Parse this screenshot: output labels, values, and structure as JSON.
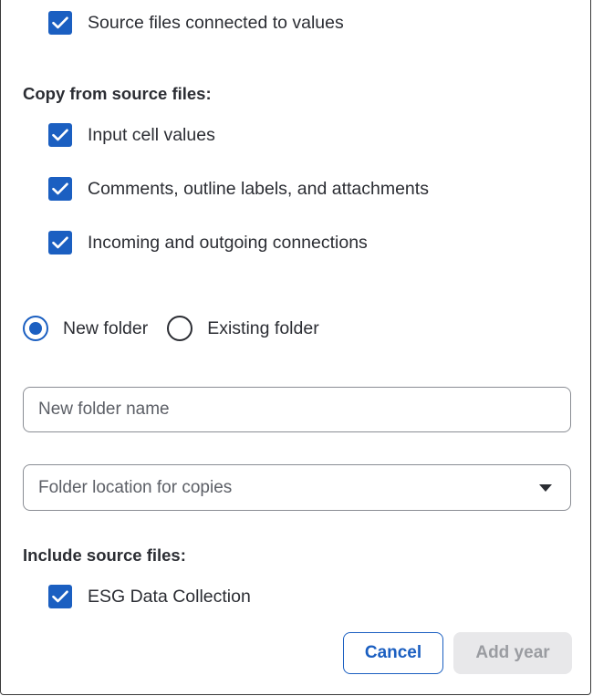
{
  "options": {
    "source_connected": {
      "label": "Source files connected to values",
      "checked": true
    }
  },
  "copy_section": {
    "title": "Copy from source files:",
    "items": [
      {
        "label": "Input cell values",
        "checked": true
      },
      {
        "label": "Comments, outline labels, and attachments",
        "checked": true
      },
      {
        "label": "Incoming and outgoing connections",
        "checked": true
      }
    ]
  },
  "folder_choice": {
    "new_label": "New folder",
    "existing_label": "Existing folder",
    "selected": "new"
  },
  "new_folder_input": {
    "placeholder": "New folder name",
    "value": ""
  },
  "location_select": {
    "placeholder": "Folder location for copies"
  },
  "include_section": {
    "title": "Include source files:",
    "items": [
      {
        "label": "ESG Data Collection",
        "checked": true
      }
    ]
  },
  "actions": {
    "cancel_label": "Cancel",
    "add_label": "Add year"
  },
  "colors": {
    "accent": "#1b5fc1",
    "text": "#2b2d33",
    "disabled_bg": "#e8e8ea",
    "disabled_text": "#9a9ca1"
  }
}
